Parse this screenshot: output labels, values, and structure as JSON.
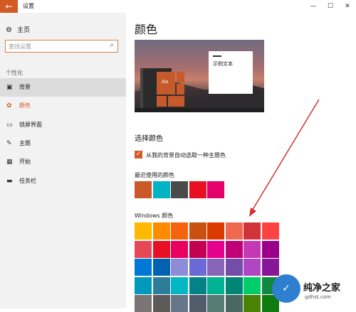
{
  "titlebar": {
    "back_glyph": "←",
    "title": "设置",
    "minimize": "—",
    "maximize": "☐",
    "close": "✕"
  },
  "sidebar": {
    "home_label": "主页",
    "search_placeholder": "查找设置",
    "section_label": "个性化",
    "items": [
      {
        "label": "背景",
        "icon": "image-icon",
        "glyph": "▣"
      },
      {
        "label": "颜色",
        "icon": "palette-icon",
        "glyph": "✿"
      },
      {
        "label": "锁屏界面",
        "icon": "lock-screen-icon",
        "glyph": "▭"
      },
      {
        "label": "主题",
        "icon": "theme-icon",
        "glyph": "✎"
      },
      {
        "label": "开始",
        "icon": "start-icon",
        "glyph": "▦"
      },
      {
        "label": "任务栏",
        "icon": "taskbar-icon",
        "glyph": "▬"
      }
    ],
    "active_item": "颜色"
  },
  "main": {
    "heading": "颜色",
    "preview": {
      "tile_text": "Aa",
      "sample_text": "示例文本"
    },
    "choose_heading": "选择颜色",
    "auto_pick_label": "从我的背景自动选取一种主题色",
    "auto_pick_checked": true,
    "recent_label": "最近使用的颜色",
    "recent_colors": [
      "#c9582a",
      "#00b4c4",
      "#4a4a4a",
      "#e81123",
      "#e3006c"
    ],
    "windows_colors_label": "Windows 颜色",
    "windows_colors": [
      [
        "#ffb900",
        "#ff8c00",
        "#f7630c",
        "#ca5010",
        "#da3b01",
        "#ef6950",
        "#d13438",
        "#ff4343"
      ],
      [
        "#e74856",
        "#e81123",
        "#ea005e",
        "#c30052",
        "#e3008c",
        "#bf0077",
        "#c239b3",
        "#9a0089"
      ],
      [
        "#0078d7",
        "#0063b1",
        "#8e8cd8",
        "#6b69d6",
        "#8764b8",
        "#744da9",
        "#b146c2",
        "#881798"
      ],
      [
        "#0099bc",
        "#2d7d9a",
        "#00b7c3",
        "#038387",
        "#00b294",
        "#018574",
        "#00cc6a",
        "#10893e"
      ],
      [
        "#7a7574",
        "#5d5a58",
        "#68768a",
        "#515c6b",
        "#567c73",
        "#486860",
        "#498205",
        "#107c10"
      ]
    ]
  },
  "watermark": {
    "glyph": "✓",
    "title": "纯净之家",
    "url": "gdhst.com"
  },
  "colors": {
    "accent": "#d35a24",
    "annotation_arrow": "#d32f2f"
  }
}
